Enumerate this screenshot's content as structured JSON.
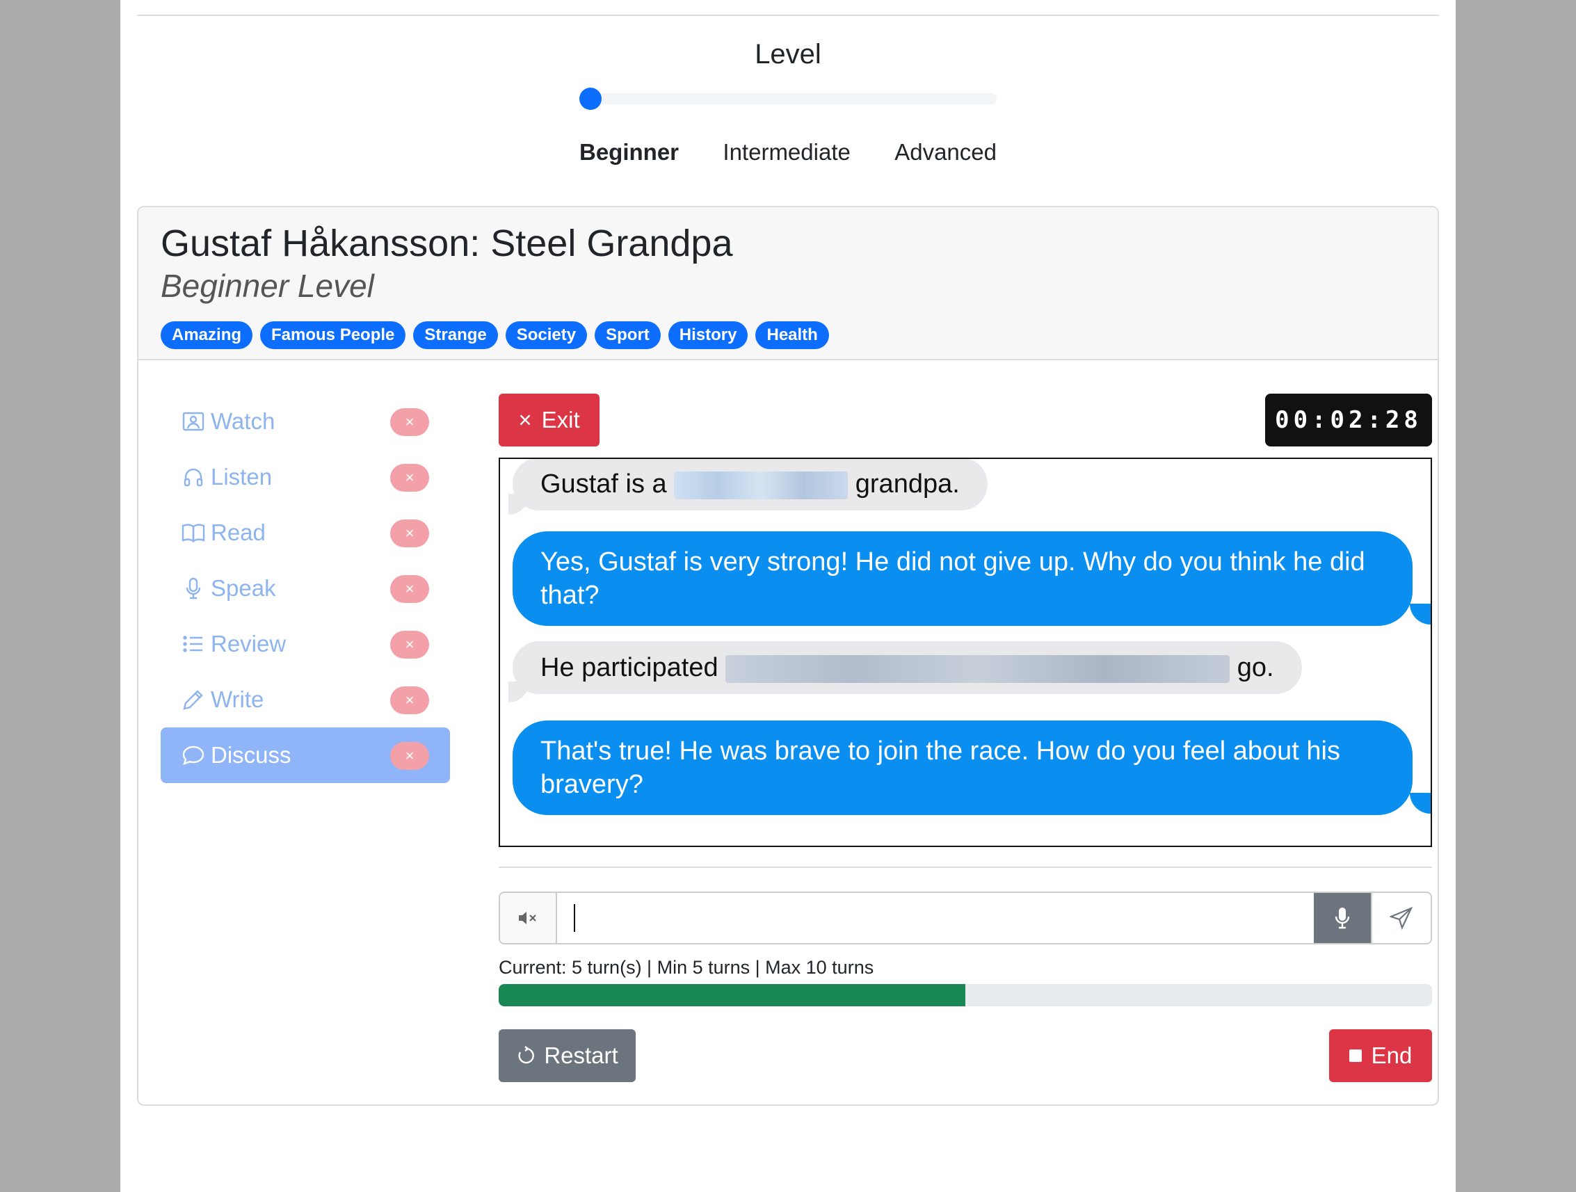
{
  "level": {
    "title": "Level",
    "options": [
      "Beginner",
      "Intermediate",
      "Advanced"
    ],
    "selected": "Beginner",
    "slider_value": 0
  },
  "lesson": {
    "title": "Gustaf Håkansson: Steel Grandpa",
    "subtitle": "Beginner Level",
    "tags": [
      "Amazing",
      "Famous People",
      "Strange",
      "Society",
      "Sport",
      "History",
      "Health"
    ]
  },
  "sidebar": {
    "items": [
      {
        "label": "Watch",
        "icon": "video-person-icon"
      },
      {
        "label": "Listen",
        "icon": "headphones-icon"
      },
      {
        "label": "Read",
        "icon": "book-icon"
      },
      {
        "label": "Speak",
        "icon": "microphone-icon"
      },
      {
        "label": "Review",
        "icon": "list-icon"
      },
      {
        "label": "Write",
        "icon": "pencil-icon"
      },
      {
        "label": "Discuss",
        "icon": "chat-bubble-icon"
      }
    ],
    "active": "Discuss",
    "badge_symbol": "×"
  },
  "session": {
    "exit_label": "Exit",
    "exit_symbol": "×",
    "timer": "00:02:28"
  },
  "chat": {
    "messages": [
      {
        "role": "user",
        "before": "Gustaf is a",
        "after": "grandpa."
      },
      {
        "role": "bot",
        "text": "Yes, Gustaf is very strong! He did not give up. Why do you think he did that?"
      },
      {
        "role": "user",
        "before": "He participated",
        "after": "go."
      },
      {
        "role": "bot",
        "text": "That's true! He was brave to join the race. How do you feel about his bravery?"
      }
    ]
  },
  "composer": {
    "value": "",
    "mute_icon": "speaker-mute-icon",
    "mic_icon": "microphone-icon",
    "send_icon": "send-icon"
  },
  "turns": {
    "text": "Current: 5 turn(s) | Min 5 turns | Max 10 turns",
    "current": 5,
    "max": 10,
    "progress_fraction": 0.5
  },
  "actions": {
    "restart_label": "Restart",
    "end_label": "End"
  },
  "colors": {
    "primary": "#0d6efd",
    "danger": "#dc3545",
    "secondary": "#6c757d",
    "success": "#198754",
    "bot_bubble": "#0a8ef0",
    "user_bubble": "#e9e9eb"
  }
}
